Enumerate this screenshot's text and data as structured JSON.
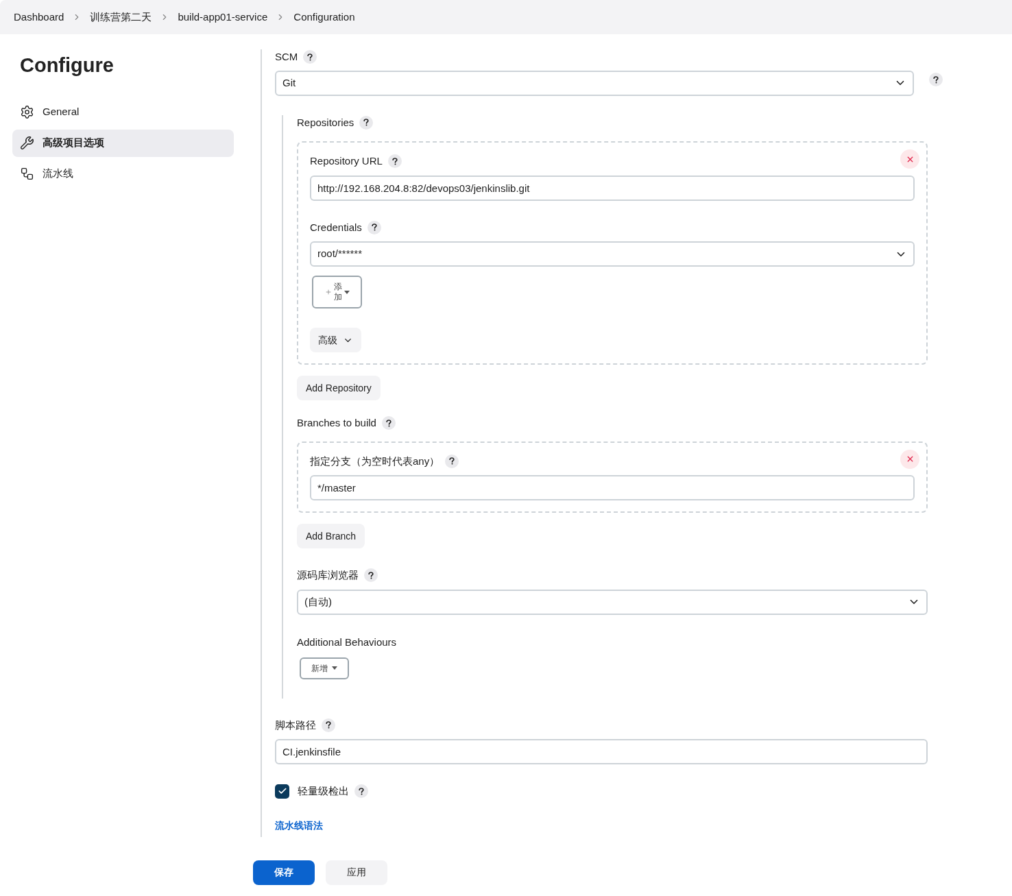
{
  "breadcrumbs": [
    "Dashboard",
    "训练营第二天",
    "build-app01-service",
    "Configuration"
  ],
  "sidebar": {
    "title": "Configure",
    "items": [
      {
        "label": "General",
        "kind": "gear",
        "selected": false
      },
      {
        "label": "高级项目选项",
        "kind": "wrench",
        "selected": true
      },
      {
        "label": "流水线",
        "kind": "pipeline",
        "selected": false
      }
    ]
  },
  "scm": {
    "label": "SCM",
    "value": "Git"
  },
  "repositories": {
    "label": "Repositories",
    "entries": [
      {
        "url_label": "Repository URL",
        "url": "http://192.168.204.8:82/devops03/jenkinslib.git",
        "credentials_label": "Credentials",
        "credentials": "root/******",
        "add_button": "添加",
        "advanced_button": "高级"
      }
    ],
    "add_button": "Add Repository"
  },
  "branches": {
    "label": "Branches to build",
    "entries": [
      {
        "label": "指定分支（为空时代表any）",
        "value": "*/master"
      }
    ],
    "add_button": "Add Branch"
  },
  "browser": {
    "label": "源码库浏览器",
    "value": "(自动)"
  },
  "behaviours": {
    "label": "Additional Behaviours",
    "add_button": "新增"
  },
  "script_path": {
    "label": "脚本路径",
    "value": "CI.jenkinsfile"
  },
  "lightweight": {
    "label": "轻量级检出",
    "checked": true
  },
  "syntax_link": "流水线语法",
  "buttons": [
    {
      "label": "保存",
      "kind": "primary"
    },
    {
      "label": "应用",
      "kind": "secondary"
    }
  ]
}
